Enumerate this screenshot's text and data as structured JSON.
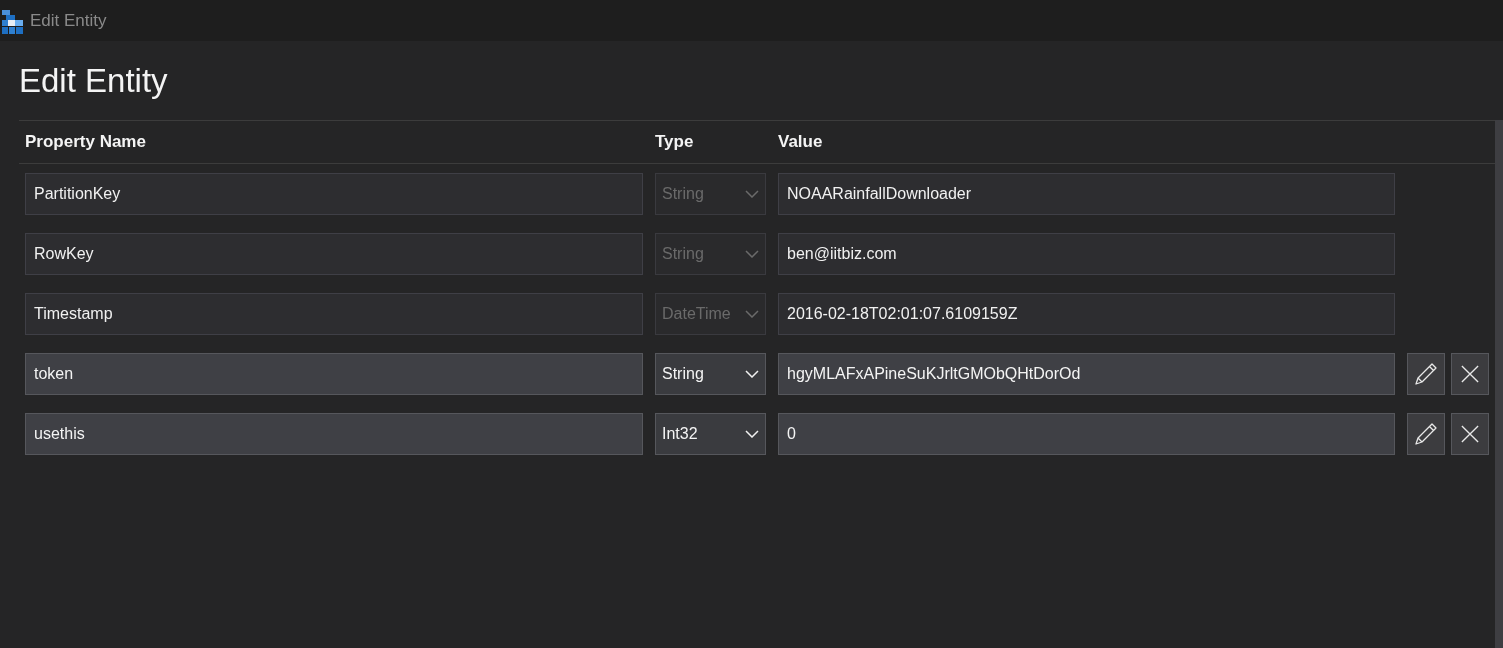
{
  "window": {
    "title": "Edit Entity"
  },
  "heading": "Edit Entity",
  "table": {
    "columns": [
      "Property Name",
      "Type",
      "Value"
    ],
    "rows": [
      {
        "name": "PartitionKey",
        "type": "String",
        "value": "NOAARainfallDownloader",
        "disabled": true
      },
      {
        "name": "RowKey",
        "type": "String",
        "value": "ben@iitbiz.com",
        "disabled": true
      },
      {
        "name": "Timestamp",
        "type": "DateTime",
        "value": "2016-02-18T02:01:07.6109159Z",
        "disabled": true
      },
      {
        "name": "token",
        "type": "String",
        "value": "hgyMLAFxAPineSuKJrltGMObQHtDorOd",
        "disabled": false
      },
      {
        "name": "usethis",
        "type": "Int32",
        "value": "0",
        "disabled": false
      }
    ]
  }
}
